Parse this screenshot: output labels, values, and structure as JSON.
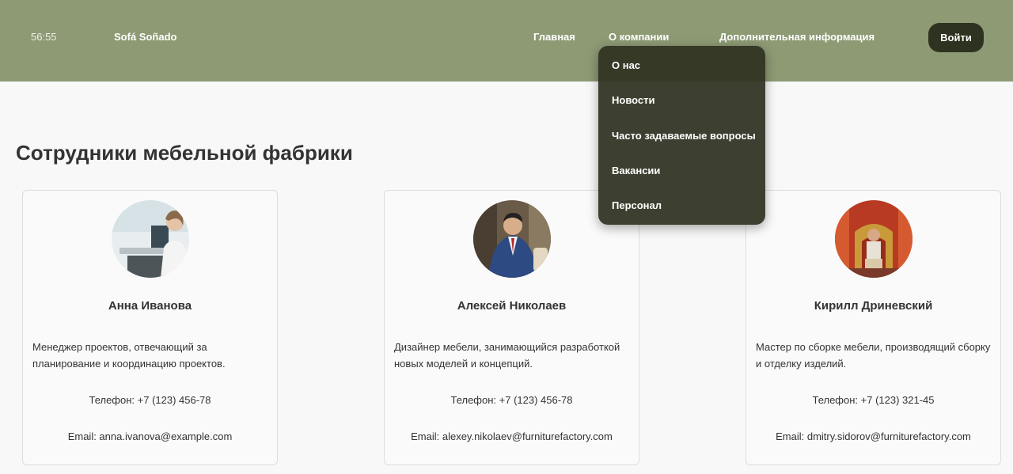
{
  "header": {
    "clock": "56:55",
    "brand": "Sofá Soñado",
    "nav": {
      "home": "Главная",
      "about": "О компании",
      "more": "Дополнительная информация"
    },
    "login": "Войти"
  },
  "dropdown": {
    "items": [
      "О нас",
      "Новости",
      "Часто задаваемые вопросы",
      "Вакансии",
      "Персонал"
    ]
  },
  "main": {
    "title": "Сотрудники мебельной фабрики",
    "employees": [
      {
        "name": "Анна Иванова",
        "description": "Менеджер проектов, отвечающий за планирование и координацию проектов.",
        "phone": "Телефон: +7 (123) 456-78",
        "email": "Email: anna.ivanova@example.com"
      },
      {
        "name": "Алексей Николаев",
        "description": "Дизайнер мебели, занимающийся разработкой новых моделей и концепций.",
        "phone": "Телефон: +7 (123) 456-78",
        "email": "Email: alexey.nikolaev@furniturefactory.com"
      },
      {
        "name": "Кирилл Дриневский",
        "description": "Мастер по сборке мебели, производящий сборку и отделку изделий.",
        "phone": "Телефон: +7 (123) 321-45",
        "email": "Email: dmitry.sidorov@furniturefactory.com"
      }
    ]
  },
  "colors": {
    "header_bg": "#8d9a74",
    "dropdown_bg": "#2e3220",
    "button_bg": "#2e3220",
    "page_bg": "#f8f8f8"
  }
}
